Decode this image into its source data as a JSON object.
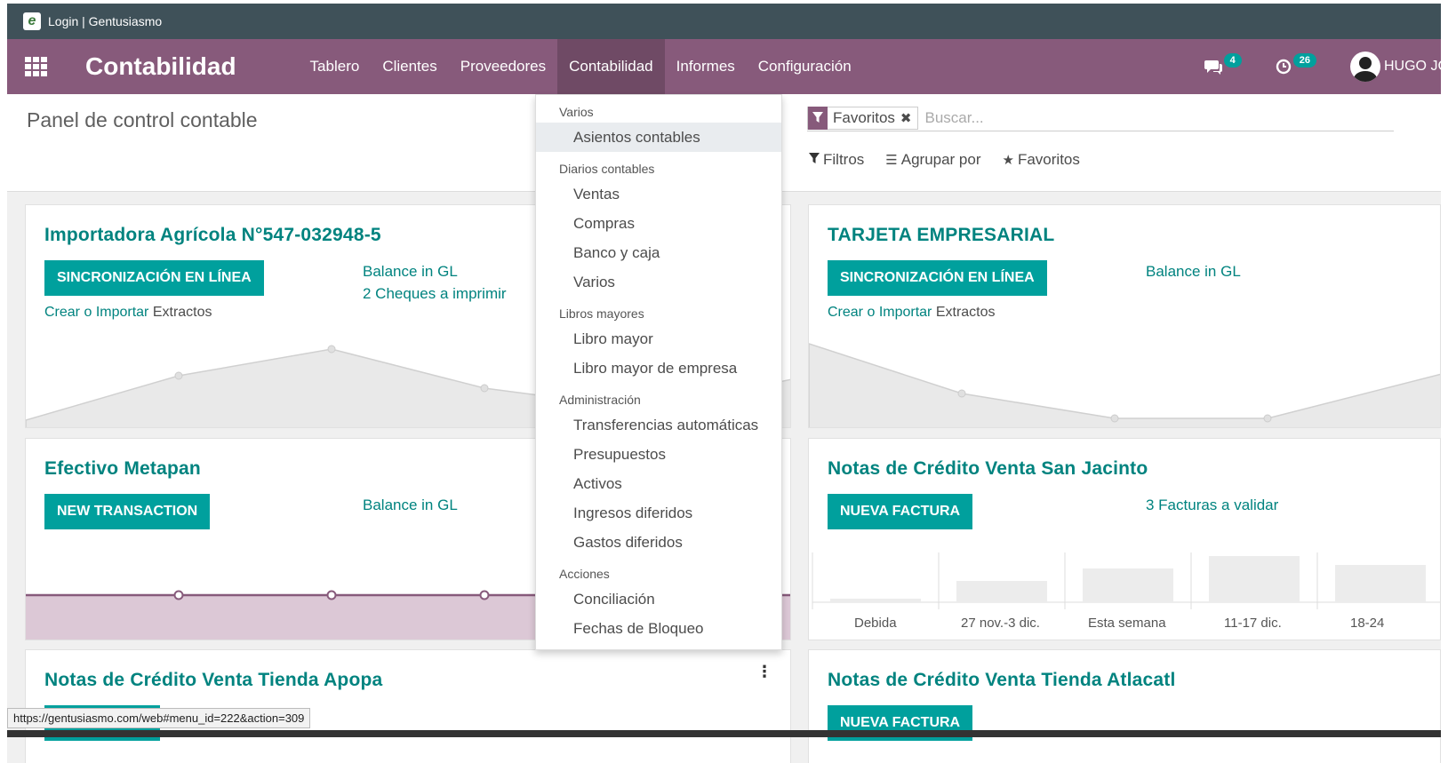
{
  "window": {
    "title": "Login | Gentusiasmo"
  },
  "navbar": {
    "brand": "Contabilidad",
    "menu": [
      "Tablero",
      "Clientes",
      "Proveedores",
      "Contabilidad",
      "Informes",
      "Configuración"
    ],
    "active_menu": "Contabilidad",
    "messages_count": "4",
    "activities_count": "26",
    "user_name": "HUGO JC"
  },
  "control_panel": {
    "title": "Panel de control contable",
    "facet_label": "Favoritos",
    "search_placeholder": "Buscar...",
    "filters_label": "Filtros",
    "group_by_label": "Agrupar por",
    "favorites_label": "Favoritos"
  },
  "dropdown": {
    "sections": [
      {
        "header": "Varios",
        "items": [
          "Asientos contables"
        ]
      },
      {
        "header": "Diarios contables",
        "items": [
          "Ventas",
          "Compras",
          "Banco y caja",
          "Varios"
        ]
      },
      {
        "header": "Libros mayores",
        "items": [
          "Libro mayor",
          "Libro mayor de empresa"
        ]
      },
      {
        "header": "Administración",
        "items": [
          "Transferencias automáticas",
          "Presupuestos",
          "Activos",
          "Ingresos diferidos",
          "Gastos diferidos"
        ]
      },
      {
        "header": "Acciones",
        "items": [
          "Conciliación",
          "Fechas de Bloqueo"
        ]
      }
    ],
    "hovered_item": "Asientos contables"
  },
  "cards": {
    "importadora": {
      "title": "Importadora Agrícola N°547-032948-5",
      "button": "SINCRONIZACIÓN EN LÍNEA",
      "crear": "Crear",
      "o": " o ",
      "importar": "Importar",
      "extractos": " Extractos",
      "balance": "Balance in GL",
      "cheques": "2 Cheques a imprimir"
    },
    "tarjeta": {
      "title": "TARJETA EMPRESARIAL",
      "button": "SINCRONIZACIÓN EN LÍNEA",
      "crear": "Crear",
      "o": " o ",
      "importar": "Importar",
      "extractos": " Extractos",
      "balance": "Balance in GL"
    },
    "efectivo": {
      "title": "Efectivo Metapan",
      "button": "NEW TRANSACTION",
      "balance": "Balance in GL"
    },
    "san_jacinto": {
      "title": "Notas de Crédito Venta San Jacinto",
      "button": "NUEVA FACTURA",
      "facturas": "3 Facturas a validar",
      "bar_labels": [
        "Debida",
        "27 nov.-3 dic.",
        "Esta semana",
        "11-17 dic.",
        "18-24"
      ]
    },
    "apopa": {
      "title": "Notas de Crédito Venta Tienda Apopa"
    },
    "atlacatl": {
      "title": "Notas de Crédito Venta Tienda Atlacatl",
      "button": "NUEVA FACTURA"
    }
  },
  "status_url": "https://gentusiasmo.com/web#menu_id=222&action=309",
  "colors": {
    "brand": "#875a7b",
    "accent": "#00a09d",
    "link": "#00837f"
  }
}
